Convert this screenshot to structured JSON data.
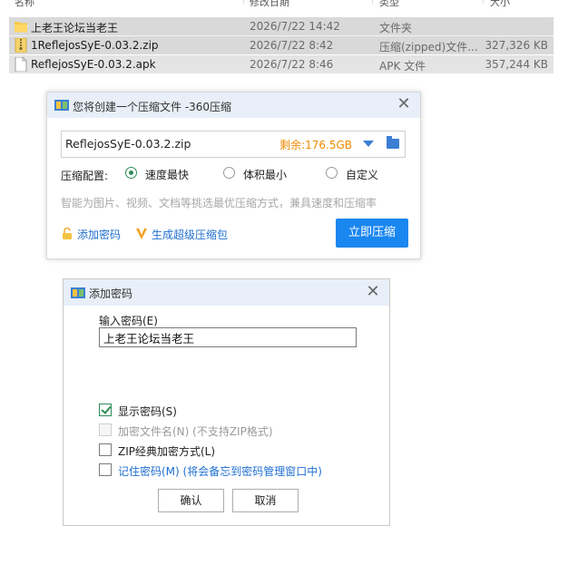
{
  "file_list": {
    "columns": [
      "名称",
      "修改日期",
      "类型",
      "大小"
    ],
    "rows": [
      {
        "icon": "folder-icon",
        "name": "上老王论坛当老王",
        "date": "2026/7/22 14:42",
        "type": "文件夹",
        "size": "",
        "selected": true
      },
      {
        "icon": "zip-file-icon",
        "name": "1ReflejosSyE-0.03.2.zip",
        "date": "2026/7/22 8:42",
        "type": "压缩(zipped)文件...",
        "size": "327,326 KB",
        "selected": true
      },
      {
        "icon": "file-icon",
        "name": "ReflejosSyE-0.03.2.apk",
        "date": "2026/7/22 8:46",
        "type": "APK 文件",
        "size": "357,244 KB",
        "selected": false
      }
    ]
  },
  "compress_dialog": {
    "title": "您将创建一个压缩文件 -360压缩",
    "filename": "ReflejosSyE-0.03.2.zip",
    "remaining": "剩余:176.5GB",
    "config_label": "压缩配置:",
    "options": [
      "速度最快",
      "体积最小",
      "自定义"
    ],
    "selected_option": "速度最快",
    "hint": "智能为图片、视频、文档等挑选最优压缩方式，兼具速度和压缩率",
    "add_password": "添加密码",
    "super_package": "生成超级压缩包",
    "compress_now": "立即压缩",
    "colors": {
      "accent": "#1a86f0",
      "remaining": "#f08a00",
      "link": "#1f6fd1"
    }
  },
  "password_dialog": {
    "title": "添加密码",
    "input_label": "输入密码(E)",
    "password_value": "上老王论坛当老王",
    "checkboxes": [
      {
        "label": "显示密码(S)",
        "checked": true,
        "enabled": true
      },
      {
        "label": "加密文件名(N) (不支持ZIP格式)",
        "checked": false,
        "enabled": false
      },
      {
        "label": "ZIP经典加密方式(L)",
        "checked": false,
        "enabled": true
      },
      {
        "label": "记住密码(M) (将会备忘到密码管理窗口中)",
        "checked": false,
        "enabled": true
      }
    ],
    "ok": "确认",
    "cancel": "取消"
  }
}
